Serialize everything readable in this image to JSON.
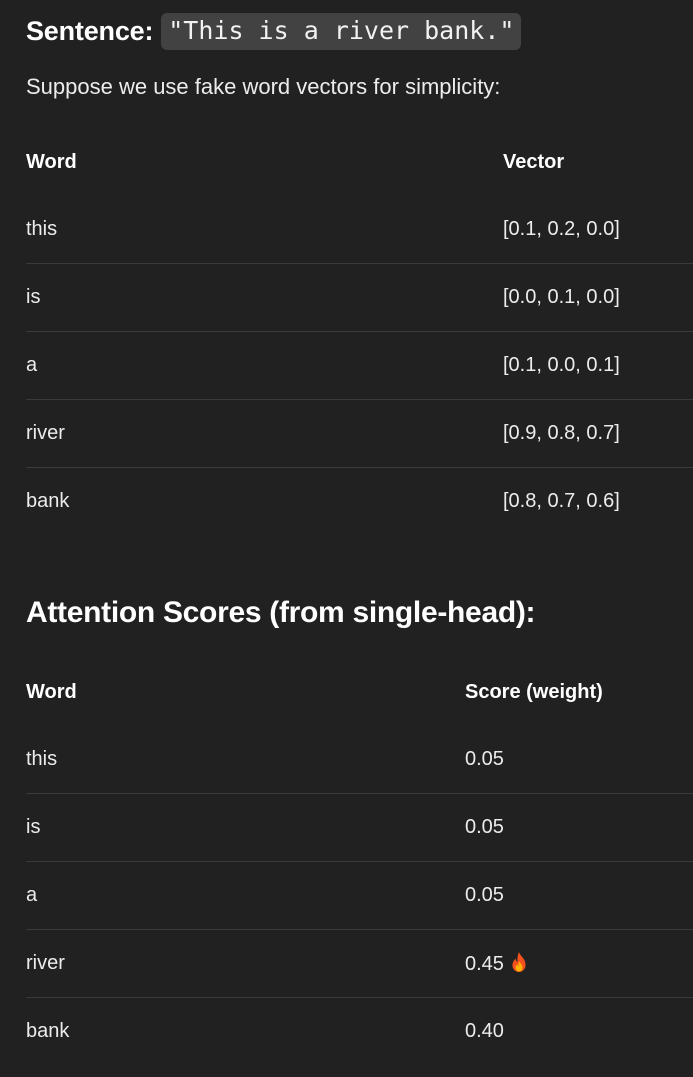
{
  "sentence": {
    "label": "Sentence:",
    "code": "\"This is a river bank.\""
  },
  "intro_text": "Suppose we use fake word vectors for simplicity:",
  "vector_table": {
    "headers": [
      "Word",
      "Vector"
    ],
    "rows": [
      {
        "word": "this",
        "vector": "[0.1, 0.2, 0.0]"
      },
      {
        "word": "is",
        "vector": "[0.0, 0.1, 0.0]"
      },
      {
        "word": "a",
        "vector": "[0.1, 0.0, 0.1]"
      },
      {
        "word": "river",
        "vector": "[0.9, 0.8, 0.7]"
      },
      {
        "word": "bank",
        "vector": "[0.8, 0.7, 0.6]"
      }
    ]
  },
  "attention": {
    "title": "Attention Scores (from single-head):",
    "headers": [
      "Word",
      "Score (weight)"
    ],
    "rows": [
      {
        "word": "this",
        "score": "0.05"
      },
      {
        "word": "is",
        "score": "0.05"
      },
      {
        "word": "a",
        "score": "0.05"
      },
      {
        "word": "river",
        "score": "0.45",
        "icon": "fire-icon"
      },
      {
        "word": "bank",
        "score": "0.40"
      }
    ]
  },
  "colors": {
    "background": "#212121",
    "code_chip": "#424242",
    "divider": "#3a3a3a",
    "text": "#ececec"
  }
}
